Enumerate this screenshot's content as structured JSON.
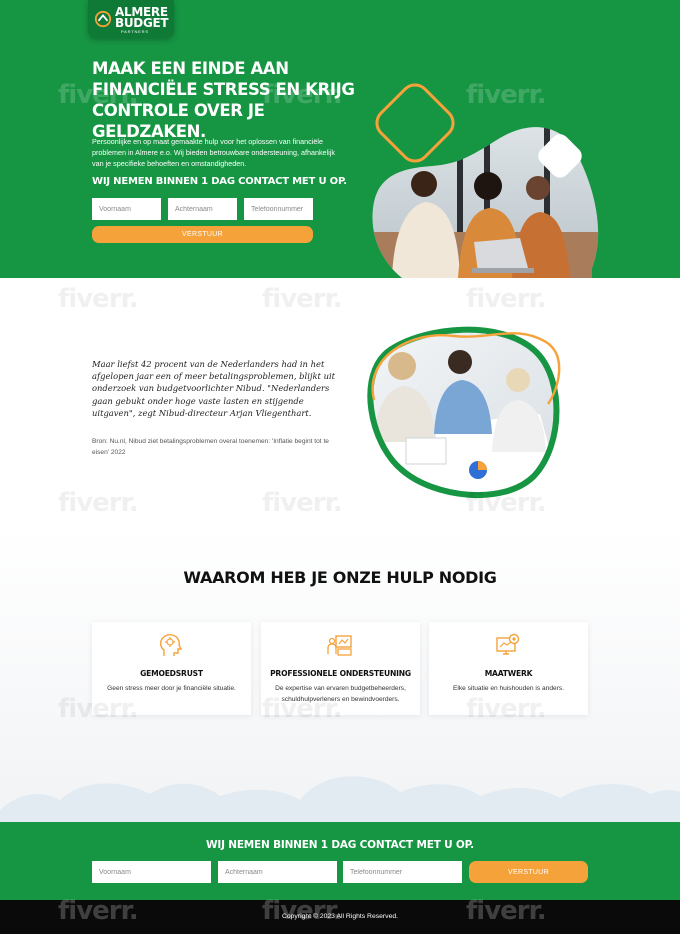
{
  "logo": {
    "line1": "ALMERE",
    "line2": "BUDGET",
    "sub": "PARTNERS"
  },
  "hero": {
    "title": "Maak een einde aan financiële stress en krijg controle over je geldzaken.",
    "text": "Persoonlijke en op maat gemaakte hulp voor het oplossen van financiële problemen in Almere e.o. Wij bieden betrouwbare ondersteuning, afhankelijk van je specifieke behoeften en omstandigheden.",
    "subtitle": "WIJ NEMEN BINNEN 1 DAG CONTACT MET U OP.",
    "form": {
      "first_name_placeholder": "Voornaam",
      "last_name_placeholder": "Achternaam",
      "phone_placeholder": "Telefoonnummer",
      "submit_label": "VERSTUUR"
    }
  },
  "quote_section": {
    "quote": "Maar liefst 42 procent van de Nederlanders had in het afgelopen jaar een of meer betalingsproblemen, blijkt uit onderzoek van budgetvoorlichter Nibud. \"Nederlanders gaan gebukt onder hoge vaste lasten en stijgende uitgaven\", zegt Nibud-directeur Arjan Vliegenthart.",
    "source": "Bron: Nu.nl, Nibud ziet betalingsproblemen overal toenemen: 'Inflatie begint tot te eisen' 2022"
  },
  "benefits": {
    "title": "WAAROM HEB JE ONZE HULP NODIG",
    "cards": [
      {
        "icon": "mind-icon",
        "title": "GEMOEDSRUST",
        "description": "Geen stress meer door je financiële situatie."
      },
      {
        "icon": "presentation-icon",
        "title": "PROFESSIONELE ONDERSTEUNING",
        "description": "De expertise van ervaren budgetbeheerders, schuldhulpverleners en bewindvoerders."
      },
      {
        "icon": "settings-monitor-icon",
        "title": "MAATWERK",
        "description": "Elke situatie en huishouden is anders."
      }
    ]
  },
  "contact": {
    "title": "WIJ NEMEN BINNEN 1 DAG CONTACT MET U OP.",
    "form": {
      "first_name_placeholder": "Voornaam",
      "last_name_placeholder": "Achternaam",
      "phone_placeholder": "Telefoonnummer",
      "submit_label": "VERSTUUR"
    }
  },
  "footer": {
    "copyright": "Copyright © 2023 All Rights Reserved."
  },
  "watermark": {
    "text": "fiverr."
  },
  "colors": {
    "brand_green": "#169543",
    "dark_green": "#0f7a36",
    "accent_orange": "#f6a23a",
    "footer_black": "#0a0a0a"
  }
}
